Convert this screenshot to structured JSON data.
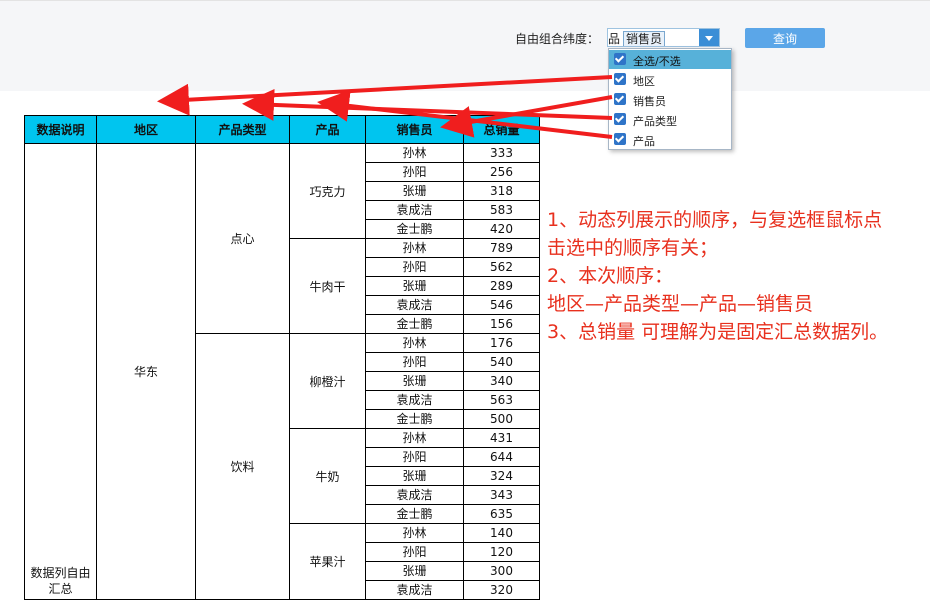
{
  "toolbar": {
    "dimension_label": "自由组合纬度：",
    "combo_prefix": "品",
    "combo_chip": "销售员",
    "query_label": "查询"
  },
  "dropdown": {
    "items": [
      {
        "label": "全选/不选",
        "checked": true,
        "selected": true
      },
      {
        "label": "地区",
        "checked": true
      },
      {
        "label": "销售员",
        "checked": true
      },
      {
        "label": "产品类型",
        "checked": true
      },
      {
        "label": "产品",
        "checked": true
      }
    ]
  },
  "table": {
    "headers": [
      "数据说明",
      "地区",
      "产品类型",
      "产品",
      "销售员",
      "总销量"
    ],
    "description": "数据列自由汇总",
    "region": "华东",
    "categories": [
      {
        "name": "点心",
        "products": [
          {
            "name": "巧克力",
            "rows": [
              [
                "孙林",
                "333"
              ],
              [
                "孙阳",
                "256"
              ],
              [
                "张珊",
                "318"
              ],
              [
                "袁成洁",
                "583"
              ],
              [
                "金士鹏",
                "420"
              ]
            ]
          },
          {
            "name": "牛肉干",
            "rows": [
              [
                "孙林",
                "789"
              ],
              [
                "孙阳",
                "562"
              ],
              [
                "张珊",
                "289"
              ],
              [
                "袁成洁",
                "546"
              ],
              [
                "金士鹏",
                "156"
              ]
            ]
          }
        ]
      },
      {
        "name": "饮料",
        "products": [
          {
            "name": "柳橙汁",
            "rows": [
              [
                "孙林",
                "176"
              ],
              [
                "孙阳",
                "540"
              ],
              [
                "张珊",
                "340"
              ],
              [
                "袁成洁",
                "563"
              ],
              [
                "金士鹏",
                "500"
              ]
            ]
          },
          {
            "name": "牛奶",
            "rows": [
              [
                "孙林",
                "431"
              ],
              [
                "孙阳",
                "644"
              ],
              [
                "张珊",
                "324"
              ],
              [
                "袁成洁",
                "343"
              ],
              [
                "金士鹏",
                "635"
              ]
            ]
          },
          {
            "name": "苹果汁",
            "rows": [
              [
                "孙林",
                "140"
              ],
              [
                "孙阳",
                "120"
              ],
              [
                "张珊",
                "300"
              ],
              [
                "袁成洁",
                "320"
              ]
            ]
          }
        ]
      }
    ]
  },
  "annotation": {
    "lines": [
      "1、动态列展示的顺序，与复选框鼠标点",
      "击选中的顺序有关；",
      "2、本次顺序：",
      "地区—产品类型—产品—销售员",
      "3、总销量 可理解为是固定汇总数据列。"
    ],
    "color": "#e8301e"
  },
  "colors": {
    "header_bg": "#00c5ef",
    "button_bg": "#5ba6e8",
    "checkbox": "#2f74c8",
    "dropdown_selected": "#57b1d9"
  }
}
